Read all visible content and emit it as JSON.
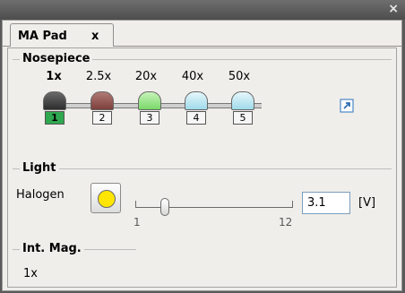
{
  "window": {
    "close_glyph": "×"
  },
  "tab": {
    "label": "MA Pad",
    "close": "x"
  },
  "sections": {
    "nosepiece": "Nosepiece",
    "light": "Light",
    "int_mag": "Int. Mag."
  },
  "nosepiece": {
    "objectives": [
      {
        "mag": "1x",
        "position": "1",
        "cap_color": "#3a3a3a",
        "active": true
      },
      {
        "mag": "2.5x",
        "position": "2",
        "cap_color": "#8a4b47",
        "active": false
      },
      {
        "mag": "20x",
        "position": "3",
        "cap_color": "#8ce07e",
        "active": false
      },
      {
        "mag": "40x",
        "position": "4",
        "cap_color": "#aee3f0",
        "active": false
      },
      {
        "mag": "50x",
        "position": "5",
        "cap_color": "#aee3f0",
        "active": false
      }
    ],
    "expand_icon": "expand-arrow-icon"
  },
  "light": {
    "source_label": "Halogen",
    "lamp_icon": "yellow-lamp-icon",
    "slider": {
      "min": "1",
      "max": "12",
      "value": 3.1
    },
    "voltage_value": "3.1",
    "unit": "[V]"
  },
  "int_mag": {
    "value": "1x"
  },
  "colors": {
    "active_position": "#2fa84f",
    "lamp": "#ffe600",
    "titlebar": "#5a5a5a"
  }
}
